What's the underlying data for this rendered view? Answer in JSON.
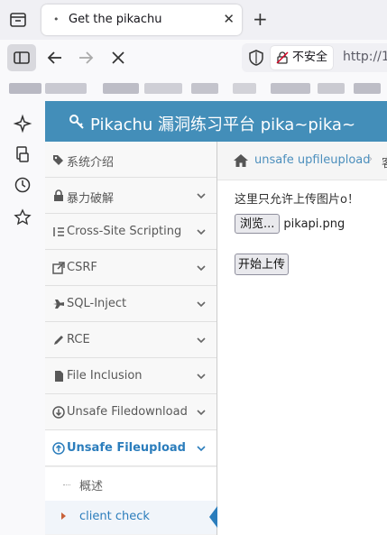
{
  "browser": {
    "tab_title": "Get the pikachu",
    "insecure_label": "不安全",
    "url_partial": "http://1"
  },
  "page": {
    "brand_title": "Pikachu 漏洞练习平台 pika~pika~",
    "nav_items": [
      {
        "label": "系统介绍",
        "icon": "tags-icon"
      },
      {
        "label": "暴力破解",
        "icon": "lock-icon"
      },
      {
        "label": "Cross-Site Scripting",
        "icon": "indent-icon"
      },
      {
        "label": "CSRF",
        "icon": "share-icon"
      },
      {
        "label": "SQL-Inject",
        "icon": "plane-icon"
      },
      {
        "label": "RCE",
        "icon": "pencil-icon"
      },
      {
        "label": "File Inclusion",
        "icon": "file-icon"
      },
      {
        "label": "Unsafe Filedownload",
        "icon": "download-icon"
      },
      {
        "label": "Unsafe Fileupload",
        "icon": "upload-icon"
      }
    ],
    "sub_items": [
      {
        "label": "概述"
      },
      {
        "label": "client check"
      }
    ],
    "breadcrumb": {
      "link": "unsafe upfileupload",
      "next": "客"
    },
    "tip_text": "这里只允许上传图片o！",
    "browse_label": "浏览...",
    "file_name": "pikapi.png",
    "upload_label": "开始上传"
  },
  "colors": {
    "header_bg": "#438eb9",
    "active_blue": "#2b7dbc"
  }
}
